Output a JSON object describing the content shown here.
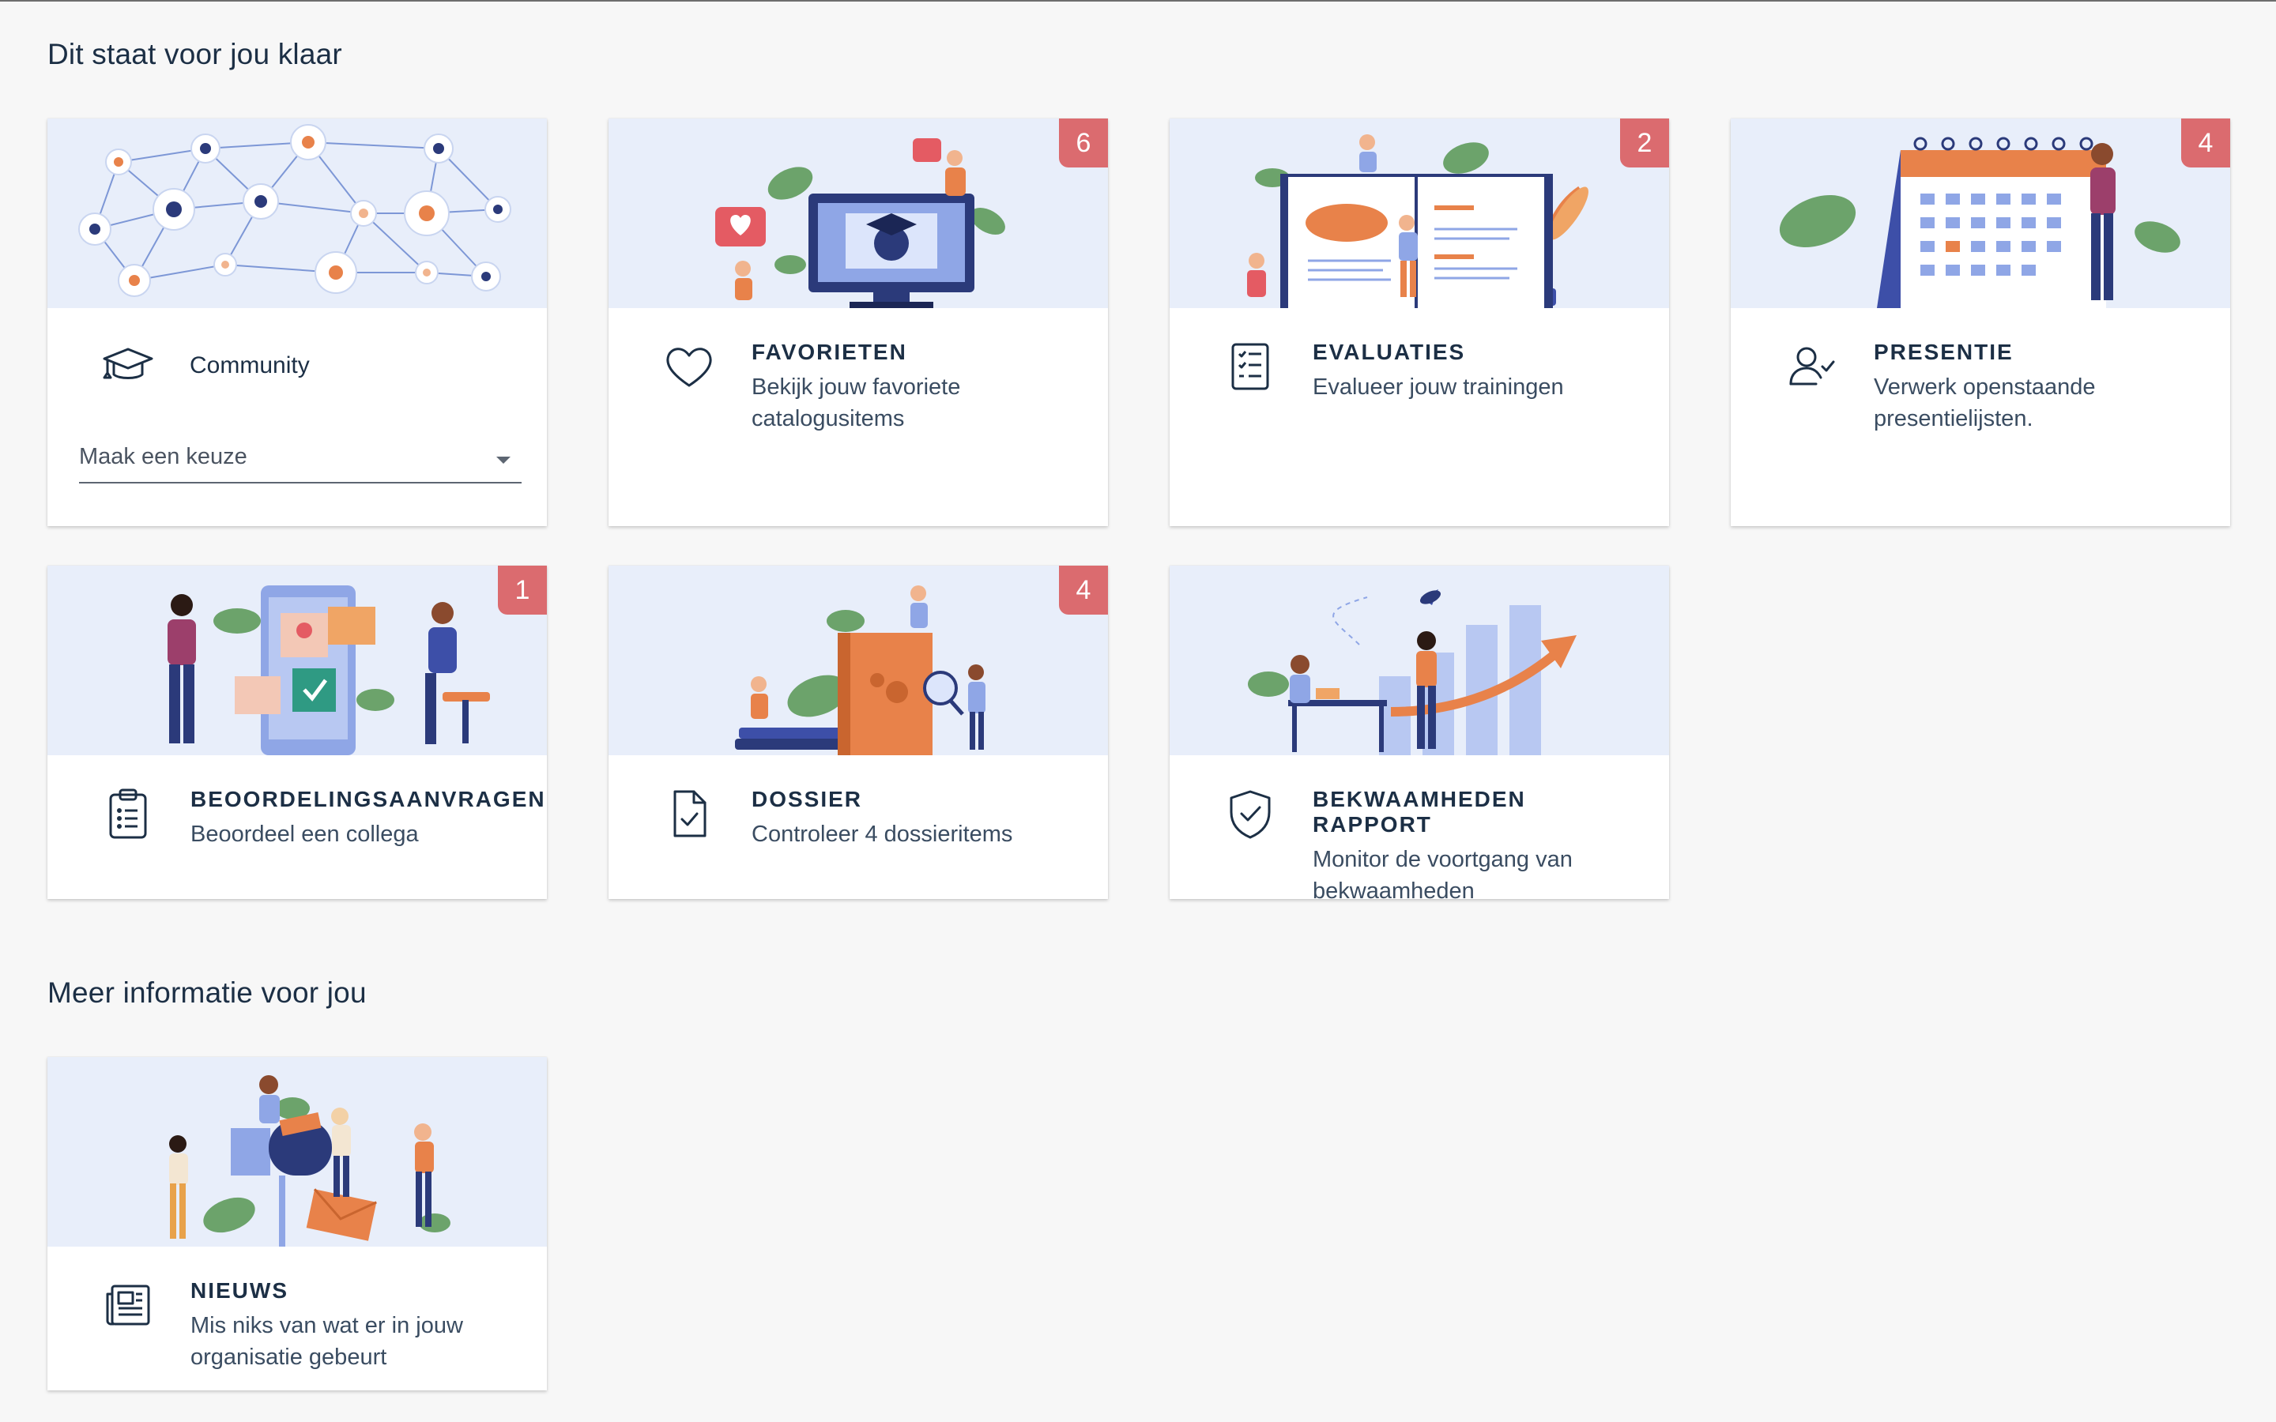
{
  "sections": {
    "main_title": "Dit staat voor jou klaar",
    "more_title": "Meer informatie voor jou"
  },
  "community": {
    "label": "Community",
    "select_value": "Maak een keuze",
    "icon": "graduation-cap-icon"
  },
  "cards": {
    "favorieten": {
      "title": "FAVORIETEN",
      "desc": "Bekijk jouw favoriete catalogusitems",
      "badge": "6",
      "icon": "heart-icon"
    },
    "evaluaties": {
      "title": "EVALUATIES",
      "desc": "Evalueer jouw trainingen",
      "badge": "2",
      "icon": "checklist-icon"
    },
    "presentie": {
      "title": "PRESENTIE",
      "desc": "Verwerk openstaande presentielijsten.",
      "badge": "4",
      "icon": "user-check-icon"
    },
    "beoordelingsaanvragen": {
      "title": "BEOORDELINGSAANVRAGEN",
      "desc": "Beoordeel een collega",
      "badge": "1",
      "icon": "clipboard-icon"
    },
    "dossier": {
      "title": "DOSSIER",
      "desc": "Controleer 4 dossieritems",
      "badge": "4",
      "icon": "file-check-icon"
    },
    "bekwaamheden": {
      "title": "BEKWAAMHEDEN RAPPORT",
      "desc": "Monitor de voortgang van bekwaamheden",
      "icon": "shield-check-icon"
    },
    "nieuws": {
      "title": "NIEUWS",
      "desc": "Mis niks van wat er in jouw organisatie gebeurt",
      "icon": "newspaper-icon"
    }
  },
  "colors": {
    "badge": "#db6b6f",
    "illustration_bg": "#e8eefa",
    "text_dark": "#1c2f45",
    "accent_orange": "#e8824a",
    "accent_blue": "#3d4fa8"
  }
}
